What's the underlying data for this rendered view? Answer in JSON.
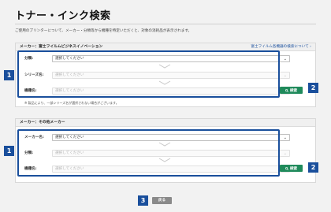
{
  "title": "トナー・インク検索",
  "intro": "ご使用のプリンターについて、メーカー・分類等から機種を特定いただくと、対象の消耗品が表示されます。",
  "fuji_panel": {
    "heading": "メーカー：富士フイルムビジネスイノベーション",
    "link": "富士フイルム各機器の検索について ›",
    "rows": [
      {
        "label": "分類:",
        "value": "選択してください",
        "enabled": true
      },
      {
        "label": "シリーズ名:",
        "value": "選択してください",
        "enabled": false
      },
      {
        "label": "機種名:",
        "value": "選択してください",
        "enabled": false
      }
    ],
    "note": "※ 製品により、一部シリーズ名が選択されない場合がございます。",
    "search_label": "検索",
    "badge_form": "1",
    "badge_search": "2"
  },
  "other_panel": {
    "heading": "メーカー：その他メーカー",
    "rows": [
      {
        "label": "メーカー名:",
        "value": "選択してください",
        "enabled": true
      },
      {
        "label": "分類:",
        "value": "選択してください",
        "enabled": false
      },
      {
        "label": "機種名:",
        "value": "選択してください",
        "enabled": false
      }
    ],
    "search_label": "検索",
    "badge_form": "1",
    "badge_search": "2"
  },
  "back": {
    "label": "戻る",
    "badge": "3"
  },
  "colors": {
    "accent_blue": "#1a4f9c",
    "search_green": "#1f8a5b",
    "back_gray": "#8a8a8a"
  },
  "icons": {
    "caret": "chevron-down-icon",
    "search": "search-icon"
  }
}
